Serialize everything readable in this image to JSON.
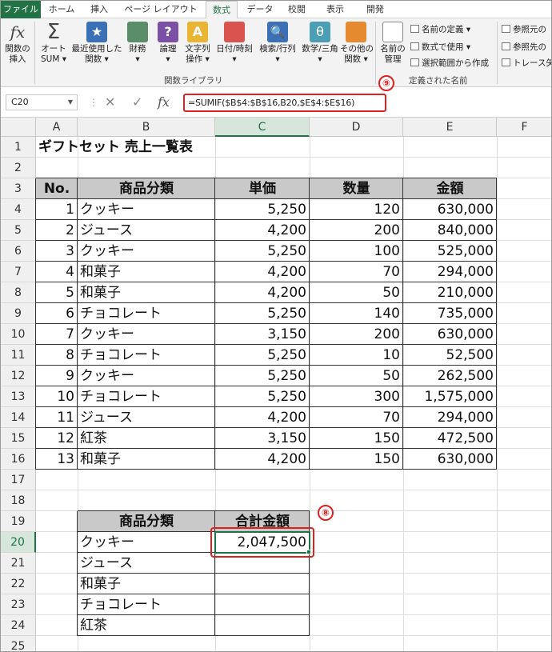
{
  "tabs": [
    "ファイル",
    "ホーム",
    "挿入",
    "ページ レイアウト",
    "数式",
    "データ",
    "校閲",
    "表示",
    "開発"
  ],
  "ribbon": {
    "insert_function": "関数の\n挿入",
    "autosum": "オート\nSUM ▾",
    "recent": "最近使用した\n関数 ▾",
    "financial": "財務\n▾",
    "logical": "論理\n▾",
    "text": "文字列\n操作 ▾",
    "datetime": "日付/時刻\n▾",
    "lookup": "検索/行列\n▾",
    "math": "数学/三角\n▾",
    "more": "その他の\n関数 ▾",
    "library_label": "関数ライブラリ",
    "name_manager": "名前の\n管理",
    "define_name": "名前の定義  ▾",
    "use_in_formula": "数式で使用 ▾",
    "create_from_selection": "選択範囲から作成",
    "defined_names_label": "定義された名前",
    "trace_precedents": "参照元の",
    "trace_dependents": "参照先の",
    "remove_arrows": "トレース矢"
  },
  "formula_bar": {
    "name_box": "C20",
    "formula": "=SUMIF($B$4:$B$16,B20,$E$4:$E$16)"
  },
  "annotations": {
    "nine": "⑨",
    "eight": "⑧"
  },
  "columns": [
    "A",
    "B",
    "C",
    "D",
    "E",
    "F"
  ],
  "rows": [
    "1",
    "2",
    "3",
    "4",
    "5",
    "6",
    "7",
    "8",
    "9",
    "10",
    "11",
    "12",
    "13",
    "14",
    "15",
    "16",
    "17",
    "18",
    "19",
    "20",
    "21",
    "22",
    "23",
    "24",
    "25"
  ],
  "sheet_title": "ギフトセット 売上一覧表",
  "table_headers": [
    "No.",
    "商品分類",
    "単価",
    "数量",
    "金額"
  ],
  "table_rows": [
    [
      "1",
      "クッキー",
      "5,250",
      "120",
      "630,000"
    ],
    [
      "2",
      "ジュース",
      "4,200",
      "200",
      "840,000"
    ],
    [
      "3",
      "クッキー",
      "5,250",
      "100",
      "525,000"
    ],
    [
      "4",
      "和菓子",
      "4,200",
      "70",
      "294,000"
    ],
    [
      "5",
      "和菓子",
      "4,200",
      "50",
      "210,000"
    ],
    [
      "6",
      "チョコレート",
      "5,250",
      "140",
      "735,000"
    ],
    [
      "7",
      "クッキー",
      "3,150",
      "200",
      "630,000"
    ],
    [
      "8",
      "チョコレート",
      "5,250",
      "10",
      "52,500"
    ],
    [
      "9",
      "クッキー",
      "5,250",
      "50",
      "262,500"
    ],
    [
      "10",
      "チョコレート",
      "5,250",
      "300",
      "1,575,000"
    ],
    [
      "11",
      "ジュース",
      "4,200",
      "70",
      "294,000"
    ],
    [
      "12",
      "紅茶",
      "3,150",
      "150",
      "472,500"
    ],
    [
      "13",
      "和菓子",
      "4,200",
      "150",
      "630,000"
    ]
  ],
  "summary_headers": [
    "商品分類",
    "合計金額"
  ],
  "summary_rows": [
    [
      "クッキー",
      "2,047,500"
    ],
    [
      "ジュース",
      ""
    ],
    [
      "和菓子",
      ""
    ],
    [
      "チョコレート",
      ""
    ],
    [
      "紅茶",
      ""
    ]
  ],
  "colors": {
    "accent": "#217346",
    "annotation": "#e02020",
    "header_fill": "#c9c9c9"
  }
}
